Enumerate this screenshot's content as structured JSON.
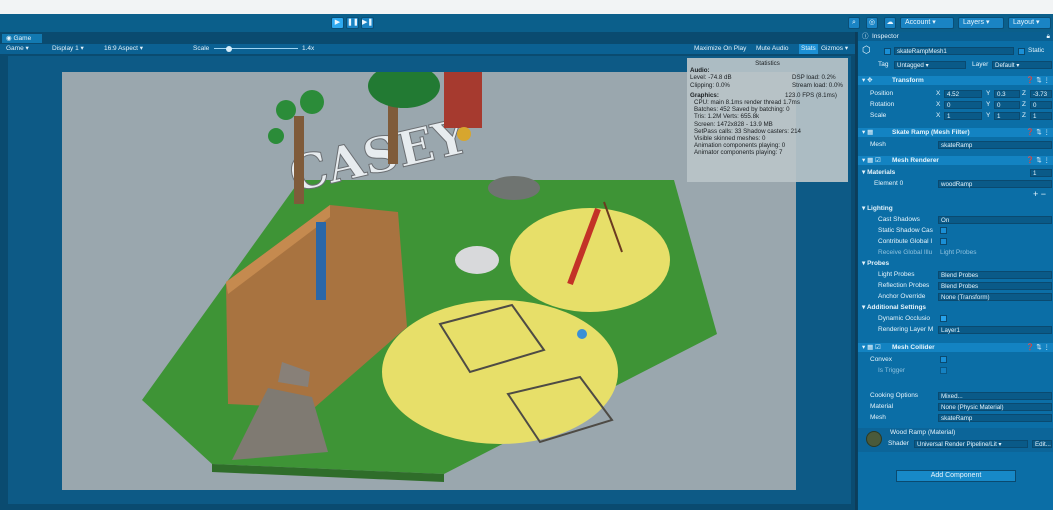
{
  "toolbar": {
    "play_icon": "play-icon",
    "pause_icon": "pause-icon",
    "step_icon": "step-icon",
    "account": "Account",
    "layers": "Layers",
    "layout": "Layout"
  },
  "game": {
    "tab": "Game",
    "view_select": "Game",
    "display": "Display 1",
    "aspect": "16:9 Aspect",
    "scale_label": "Scale",
    "scale_value": "1.4x",
    "maximize": "Maximize On Play",
    "mute": "Mute Audio",
    "stats": "Stats",
    "gizmos": "Gizmos"
  },
  "scene": {
    "sign_text": "CASEY"
  },
  "stats": {
    "title": "Statistics",
    "audio_h": "Audio:",
    "level": "Level: -74.8 dB",
    "dsp": "DSP load: 0.2%",
    "clipping": "Clipping: 0.0%",
    "stream": "Stream load: 0.0%",
    "graphics_h": "Graphics:",
    "fps": "123.0 FPS (8.1ms)",
    "cpu": "CPU: main 8.1ms  render thread 1.7ms",
    "batches": "Batches: 452  Saved by batching: 0",
    "tris": "Tris: 1.2M      Verts: 655.8k",
    "screen": "Screen: 1472x828 - 13.9 MB",
    "setpass": "SetPass calls: 33      Shadow casters: 214",
    "skinned": "Visible skinned meshes: 0",
    "anim": "Animation components playing: 0",
    "animator": "Animator components playing: 7"
  },
  "inspector": {
    "tab": "Inspector",
    "object_name": "skateRampMesh1",
    "static": "Static",
    "tag_label": "Tag",
    "tag": "Untagged",
    "layer_label": "Layer",
    "layer": "Default",
    "transform": {
      "title": "Transform",
      "position": "Position",
      "rotation": "Rotation",
      "scale": "Scale",
      "pos": [
        "4.52",
        "0.3",
        "-3.73"
      ],
      "rot": [
        "0",
        "0",
        "0"
      ],
      "scl": [
        "1",
        "1",
        "1"
      ]
    },
    "meshfilter": {
      "title": "Skate Ramp (Mesh Filter)",
      "mesh_label": "Mesh",
      "mesh": "skateRamp"
    },
    "renderer": {
      "title": "Mesh Renderer",
      "materials": "Materials",
      "count": "1",
      "element_label": "Element 0",
      "element": "woodRamp",
      "lighting": "Lighting",
      "cast_shadows": "Cast Shadows",
      "cast_shadows_val": "On",
      "static_shadow": "Static Shadow Cas",
      "contribute_gi": "Contribute Global I",
      "receive_gi": "Receive Global Illu",
      "receive_gi_val": "Light Probes",
      "probes": "Probes",
      "light_probes": "Light Probes",
      "light_probes_val": "Blend Probes",
      "reflection_probes": "Reflection Probes",
      "reflection_probes_val": "Blend Probes",
      "anchor": "Anchor Override",
      "anchor_val": "None (Transform)",
      "additional": "Additional Settings",
      "dynamic": "Dynamic Occlusio",
      "rendering_layer": "Rendering Layer M",
      "rendering_layer_val": "Layer1"
    },
    "collider": {
      "title": "Mesh Collider",
      "convex": "Convex",
      "trigger": "Is Trigger",
      "cooking": "Cooking Options",
      "cooking_val": "Mixed...",
      "material_label": "Material",
      "material_val": "None (Physic Material)",
      "mesh_label": "Mesh",
      "mesh_val": "skateRamp"
    },
    "material": {
      "title": "Wood Ramp (Material)",
      "shader_label": "Shader",
      "shader": "Universal Render Pipeline/Lit",
      "edit": "Edit..."
    },
    "add_component": "Add Component"
  },
  "colors": {
    "accent": "#0b6ea6",
    "grass": "#3f9a3a",
    "sand": "#e8e06a"
  }
}
